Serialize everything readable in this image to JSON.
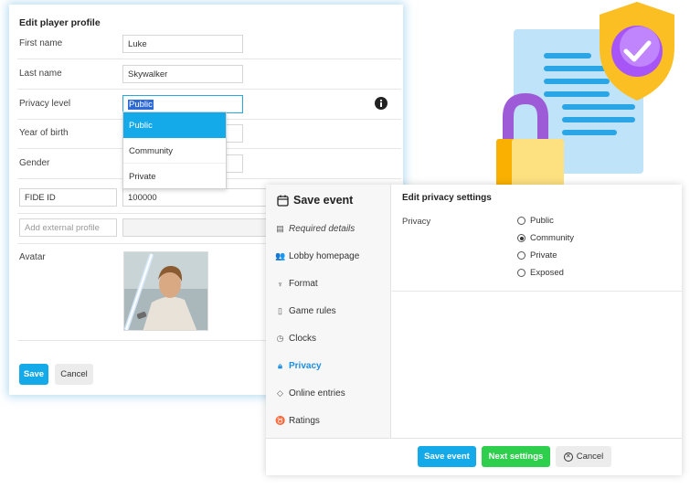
{
  "profile": {
    "title": "Edit player profile",
    "fields": {
      "first_name": {
        "label": "First name",
        "value": "Luke"
      },
      "last_name": {
        "label": "Last name",
        "value": "Skywalker"
      },
      "privacy": {
        "label": "Privacy level",
        "value": "Public"
      },
      "year": {
        "label": "Year of birth"
      },
      "gender": {
        "label": "Gender"
      },
      "fide": {
        "label": "FIDE ID",
        "value": "100000"
      },
      "external": {
        "placeholder": "Add external profile"
      },
      "avatar": {
        "label": "Avatar"
      }
    },
    "dropdown_options": [
      "Public",
      "Community",
      "Private"
    ],
    "save_label": "Save",
    "cancel_label": "Cancel"
  },
  "event": {
    "title": "Save event",
    "nav": [
      {
        "label": "Required details",
        "icon": "list-icon"
      },
      {
        "label": "Lobby homepage",
        "icon": "users-icon"
      },
      {
        "label": "Format",
        "icon": "trophy-icon"
      },
      {
        "label": "Game rules",
        "icon": "document-icon"
      },
      {
        "label": "Clocks",
        "icon": "clock-icon"
      },
      {
        "label": "Privacy",
        "icon": "lock-icon"
      },
      {
        "label": "Online entries",
        "icon": "tag-icon"
      },
      {
        "label": "Ratings",
        "icon": "medal-icon"
      }
    ],
    "settings_title": "Edit privacy settings",
    "privacy_label": "Privacy",
    "options": [
      "Public",
      "Community",
      "Private",
      "Exposed"
    ],
    "selected": "Community",
    "save_event_label": "Save event",
    "next_label": "Next settings",
    "cancel_label": "Cancel"
  },
  "colors": {
    "primary": "#14a9e8",
    "success": "#2ecf4d",
    "shield": "#fbbf24",
    "check_circle": "#a855f7"
  }
}
